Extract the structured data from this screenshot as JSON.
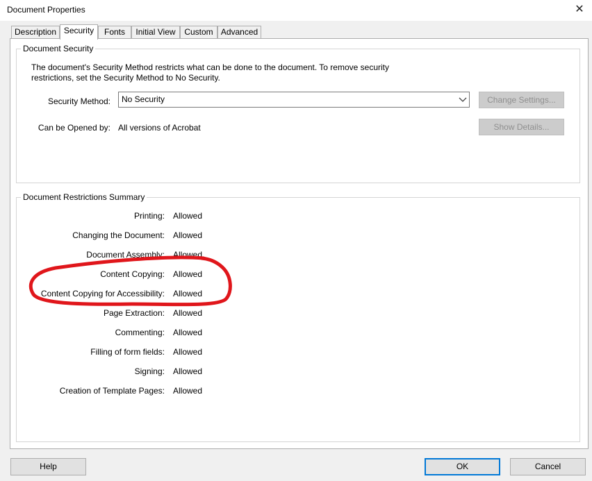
{
  "window": {
    "title": "Document Properties",
    "close_glyph": "✕"
  },
  "tabs": [
    {
      "label": "Description"
    },
    {
      "label": "Security"
    },
    {
      "label": "Fonts"
    },
    {
      "label": "Initial View"
    },
    {
      "label": "Custom"
    },
    {
      "label": "Advanced"
    }
  ],
  "active_tab": "Security",
  "security_group": {
    "title": "Document Security",
    "description": "The document's Security Method restricts what can be done to the document. To remove security restrictions, set the Security Method to No Security.",
    "method_label": "Security Method:",
    "method_value": "No Security",
    "opened_by_label": "Can be Opened by:",
    "opened_by_value": "All versions of Acrobat",
    "change_settings_button": "Change Settings...",
    "show_details_button": "Show Details..."
  },
  "restrictions": {
    "title": "Document Restrictions Summary",
    "rows": [
      {
        "label": "Printing:",
        "value": "Allowed"
      },
      {
        "label": "Changing the Document:",
        "value": "Allowed"
      },
      {
        "label": "Document Assembly:",
        "value": "Allowed"
      },
      {
        "label": "Content Copying:",
        "value": "Allowed"
      },
      {
        "label": "Content Copying for Accessibility:",
        "value": "Allowed"
      },
      {
        "label": "Page Extraction:",
        "value": "Allowed"
      },
      {
        "label": "Commenting:",
        "value": "Allowed"
      },
      {
        "label": "Filling of form fields:",
        "value": "Allowed"
      },
      {
        "label": "Signing:",
        "value": "Allowed"
      },
      {
        "label": "Creation of Template Pages:",
        "value": "Allowed"
      }
    ]
  },
  "footer": {
    "help_button": "Help",
    "ok_button": "OK",
    "cancel_button": "Cancel"
  },
  "colors": {
    "annotation_ink": "#e0161b",
    "focus_border": "#0078d7",
    "disabled_button_bg": "#cccccc"
  }
}
